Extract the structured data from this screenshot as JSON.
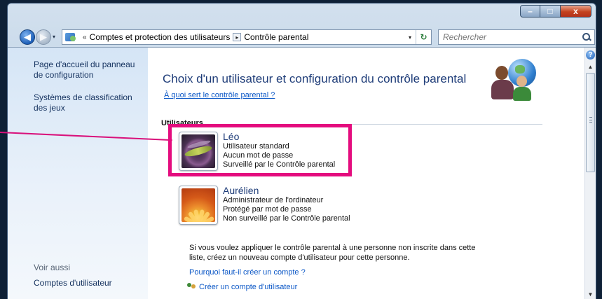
{
  "window": {
    "minimize": "–",
    "maximize": "□",
    "close": "x"
  },
  "nav": {
    "back": "◀",
    "forward": "▶",
    "history_dropdown": "▾"
  },
  "address": {
    "overflow": "«",
    "crumbs": [
      "Comptes et protection des utilisateurs",
      "Contrôle parental"
    ],
    "separator": "▸",
    "dropdown": "▾",
    "refresh": "↻"
  },
  "search": {
    "placeholder": "Rechercher"
  },
  "sidebar": {
    "links": [
      "Page d'accueil du panneau de configuration",
      "Systèmes de classification des jeux"
    ],
    "see_also_label": "Voir aussi",
    "see_also_links": [
      "Comptes d'utilisateur"
    ]
  },
  "main": {
    "heading": "Choix d'un utilisateur et configuration du contrôle parental",
    "help_link": "À quoi sert le contrôle parental ?",
    "section_label": "Utilisateurs",
    "users": [
      {
        "name": "Léo",
        "lines": [
          "Utilisateur standard",
          "Aucun mot de passe",
          "Surveillé par le Contrôle parental"
        ]
      },
      {
        "name": "Aurélien",
        "lines": [
          "Administrateur de l'ordinateur",
          "Protégé par mot de passe",
          "Non surveillé par le Contrôle parental"
        ]
      }
    ],
    "note": "Si vous voulez appliquer le contrôle parental à une personne non inscrite dans cette liste, créez un nouveau compte d'utilisateur pour cette personne.",
    "why_create_link": "Pourquoi faut-il créer un compte ?",
    "create_link": "Créer un compte d'utilisateur"
  },
  "scrollbar": {
    "help": "?",
    "up": "▲",
    "down": "▼"
  },
  "colors": {
    "highlight": "#e40c7e",
    "link": "#0b57c6",
    "heading": "#1e3c78"
  }
}
